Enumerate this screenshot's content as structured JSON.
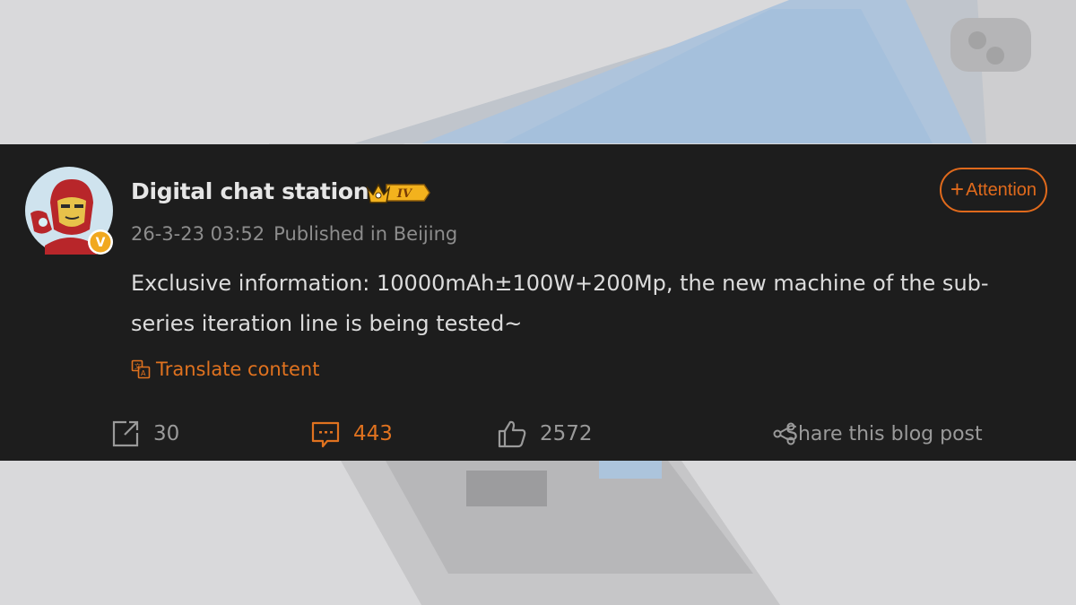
{
  "post": {
    "author": "Digital chat station",
    "badge_level": "IV",
    "date": "26-3-23 03:52",
    "location": "Published in Beijing",
    "follow_label": "Attention",
    "follow_icon": "plus-icon",
    "text": "Exclusive information: 10000mAh±100W+200Mp, the new machine of the sub-series iteration line is being tested~",
    "translate_label": "Translate content"
  },
  "actions": {
    "repost_count": "30",
    "comment_count": "443",
    "like_count": "2572",
    "share_label": "Share this blog post"
  },
  "colors": {
    "accent": "#e0721f",
    "panel": "#1d1d1d",
    "text": "#dcdcdc",
    "muted": "#8d8d8d"
  }
}
